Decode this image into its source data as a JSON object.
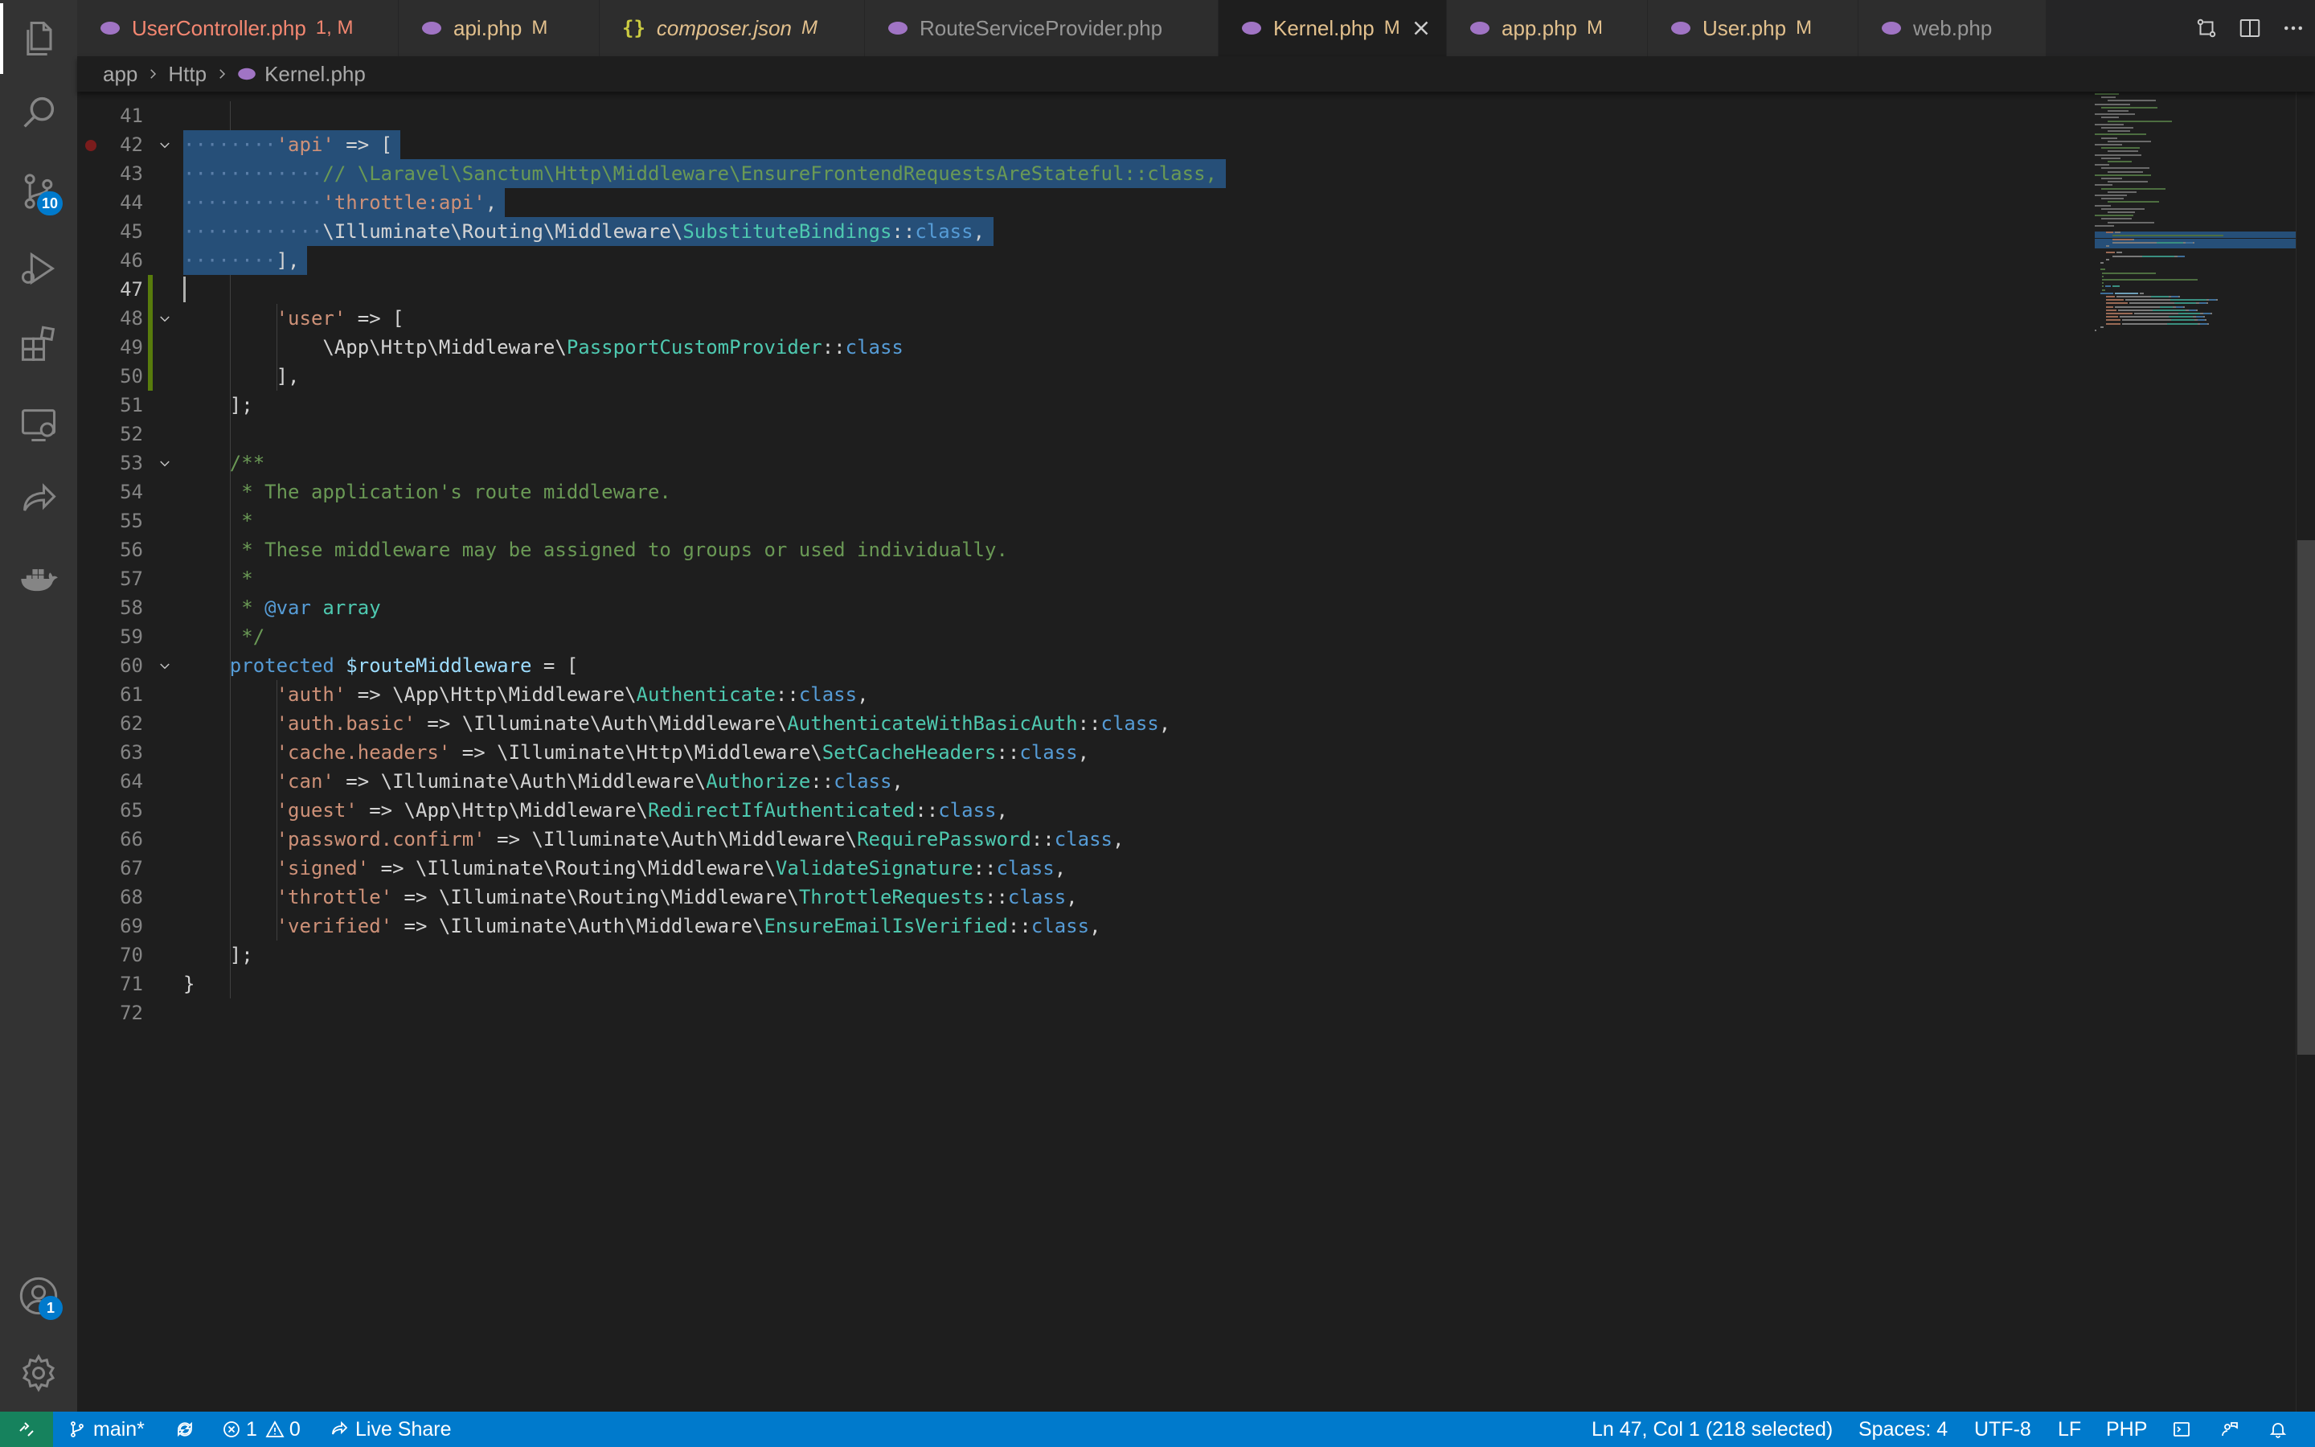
{
  "activity_bar": {
    "items": [
      {
        "name": "explorer-icon"
      },
      {
        "name": "search-icon"
      },
      {
        "name": "source-control-icon",
        "badge": "10"
      },
      {
        "name": "run-debug-icon"
      },
      {
        "name": "extensions-icon"
      },
      {
        "name": "remote-explorer-icon"
      },
      {
        "name": "live-share-icon"
      },
      {
        "name": "docker-icon"
      }
    ],
    "accounts_badge": "1"
  },
  "tabs": [
    {
      "label": "UserController.php",
      "status": "1, M",
      "icon": "php-icon",
      "color": "#f48771"
    },
    {
      "label": "api.php",
      "status": "M",
      "icon": "php-icon",
      "color": "#e2c08d"
    },
    {
      "label": "composer.json",
      "status": "M",
      "icon": "json-icon",
      "icon_text": "{}",
      "color": "#e2c08d"
    },
    {
      "label": "RouteServiceProvider.php",
      "status": "",
      "icon": "php-icon",
      "color": "#969696"
    },
    {
      "label": "Kernel.php",
      "status": "M",
      "icon": "php-icon",
      "color": "#e2c08d",
      "active": true
    },
    {
      "label": "app.php",
      "status": "M",
      "icon": "php-icon",
      "color": "#e2c08d"
    },
    {
      "label": "User.php",
      "status": "M",
      "icon": "php-icon",
      "color": "#e2c08d"
    },
    {
      "label": "web.php",
      "status": "",
      "icon": "php-icon",
      "color": "#969696"
    }
  ],
  "breadcrumb": {
    "parts": [
      "app",
      "Http",
      "Kernel.php"
    ]
  },
  "editor": {
    "first_line": 41,
    "current_line": 47,
    "lines": [
      [
        [
          "d",
          "        "
        ]
      ],
      [
        [
          "ws",
          "········"
        ],
        [
          "s",
          "'api'"
        ],
        [
          "d",
          " => ["
        ]
      ],
      [
        [
          "ws",
          "············"
        ],
        [
          "c",
          "// \\Laravel\\Sanctum\\Http\\Middleware\\EnsureFrontendRequestsAreStateful::class,"
        ]
      ],
      [
        [
          "ws",
          "············"
        ],
        [
          "s",
          "'throttle:api'"
        ],
        [
          "d",
          ","
        ]
      ],
      [
        [
          "ws",
          "············"
        ],
        [
          "d",
          "\\Illuminate\\Routing\\Middleware\\"
        ],
        [
          "t",
          "SubstituteBindings"
        ],
        [
          "d",
          "::"
        ],
        [
          "k",
          "class"
        ],
        [
          "d",
          ","
        ]
      ],
      [
        [
          "ws",
          "········"
        ],
        [
          "d",
          "],"
        ]
      ],
      [
        [
          "d",
          ""
        ]
      ],
      [
        [
          "d",
          "        "
        ],
        [
          "s",
          "'user'"
        ],
        [
          "d",
          " => ["
        ]
      ],
      [
        [
          "d",
          "            \\App\\Http\\Middleware\\"
        ],
        [
          "t",
          "PassportCustomProvider"
        ],
        [
          "d",
          "::"
        ],
        [
          "k",
          "class"
        ]
      ],
      [
        [
          "d",
          "        ],"
        ]
      ],
      [
        [
          "d",
          "    ];"
        ]
      ],
      [
        [
          "d",
          ""
        ]
      ],
      [
        [
          "d",
          "    "
        ],
        [
          "c",
          "/**"
        ]
      ],
      [
        [
          "c",
          "     * The application's route middleware."
        ]
      ],
      [
        [
          "c",
          "     *"
        ]
      ],
      [
        [
          "c",
          "     * These middleware may be assigned to groups or used individually."
        ]
      ],
      [
        [
          "c",
          "     *"
        ]
      ],
      [
        [
          "c",
          "     * "
        ],
        [
          "k",
          "@var"
        ],
        [
          "c",
          " "
        ],
        [
          "t",
          "array"
        ]
      ],
      [
        [
          "c",
          "     */"
        ]
      ],
      [
        [
          "d",
          "    "
        ],
        [
          "k",
          "protected"
        ],
        [
          "d",
          " "
        ],
        [
          "v",
          "$routeMiddleware"
        ],
        [
          "d",
          " = ["
        ]
      ],
      [
        [
          "d",
          "        "
        ],
        [
          "s",
          "'auth'"
        ],
        [
          "d",
          " => \\App\\Http\\Middleware\\"
        ],
        [
          "t",
          "Authenticate"
        ],
        [
          "d",
          "::"
        ],
        [
          "k",
          "class"
        ],
        [
          "d",
          ","
        ]
      ],
      [
        [
          "d",
          "        "
        ],
        [
          "s",
          "'auth.basic'"
        ],
        [
          "d",
          " => \\Illuminate\\Auth\\Middleware\\"
        ],
        [
          "t",
          "AuthenticateWithBasicAuth"
        ],
        [
          "d",
          "::"
        ],
        [
          "k",
          "class"
        ],
        [
          "d",
          ","
        ]
      ],
      [
        [
          "d",
          "        "
        ],
        [
          "s",
          "'cache.headers'"
        ],
        [
          "d",
          " => \\Illuminate\\Http\\Middleware\\"
        ],
        [
          "t",
          "SetCacheHeaders"
        ],
        [
          "d",
          "::"
        ],
        [
          "k",
          "class"
        ],
        [
          "d",
          ","
        ]
      ],
      [
        [
          "d",
          "        "
        ],
        [
          "s",
          "'can'"
        ],
        [
          "d",
          " => \\Illuminate\\Auth\\Middleware\\"
        ],
        [
          "t",
          "Authorize"
        ],
        [
          "d",
          "::"
        ],
        [
          "k",
          "class"
        ],
        [
          "d",
          ","
        ]
      ],
      [
        [
          "d",
          "        "
        ],
        [
          "s",
          "'guest'"
        ],
        [
          "d",
          " => \\App\\Http\\Middleware\\"
        ],
        [
          "t",
          "RedirectIfAuthenticated"
        ],
        [
          "d",
          "::"
        ],
        [
          "k",
          "class"
        ],
        [
          "d",
          ","
        ]
      ],
      [
        [
          "d",
          "        "
        ],
        [
          "s",
          "'password.confirm'"
        ],
        [
          "d",
          " => \\Illuminate\\Auth\\Middleware\\"
        ],
        [
          "t",
          "RequirePassword"
        ],
        [
          "d",
          "::"
        ],
        [
          "k",
          "class"
        ],
        [
          "d",
          ","
        ]
      ],
      [
        [
          "d",
          "        "
        ],
        [
          "s",
          "'signed'"
        ],
        [
          "d",
          " => \\Illuminate\\Routing\\Middleware\\"
        ],
        [
          "t",
          "ValidateSignature"
        ],
        [
          "d",
          "::"
        ],
        [
          "k",
          "class"
        ],
        [
          "d",
          ","
        ]
      ],
      [
        [
          "d",
          "        "
        ],
        [
          "s",
          "'throttle'"
        ],
        [
          "d",
          " => \\Illuminate\\Routing\\Middleware\\"
        ],
        [
          "t",
          "ThrottleRequests"
        ],
        [
          "d",
          "::"
        ],
        [
          "k",
          "class"
        ],
        [
          "d",
          ","
        ]
      ],
      [
        [
          "d",
          "        "
        ],
        [
          "s",
          "'verified'"
        ],
        [
          "d",
          " => \\Illuminate\\Auth\\Middleware\\"
        ],
        [
          "t",
          "EnsureEmailIsVerified"
        ],
        [
          "d",
          "::"
        ],
        [
          "k",
          "class"
        ],
        [
          "d",
          ","
        ]
      ],
      [
        [
          "d",
          "    ];"
        ]
      ],
      [
        [
          "d",
          "}"
        ]
      ],
      [
        [
          "d",
          ""
        ]
      ]
    ]
  },
  "statusbar": {
    "branch": "main*",
    "errors": "1",
    "warnings": "0",
    "live_share": "Live Share",
    "position": "Ln 47, Col 1 (218 selected)",
    "spaces": "Spaces: 4",
    "encoding": "UTF-8",
    "eol": "LF",
    "language": "PHP"
  },
  "colors": {
    "statusbar": "#007acc",
    "selection": "#264f78",
    "git_added": "#587c0c",
    "tab_modified": "#e2c08d",
    "tab_error": "#f48771"
  }
}
